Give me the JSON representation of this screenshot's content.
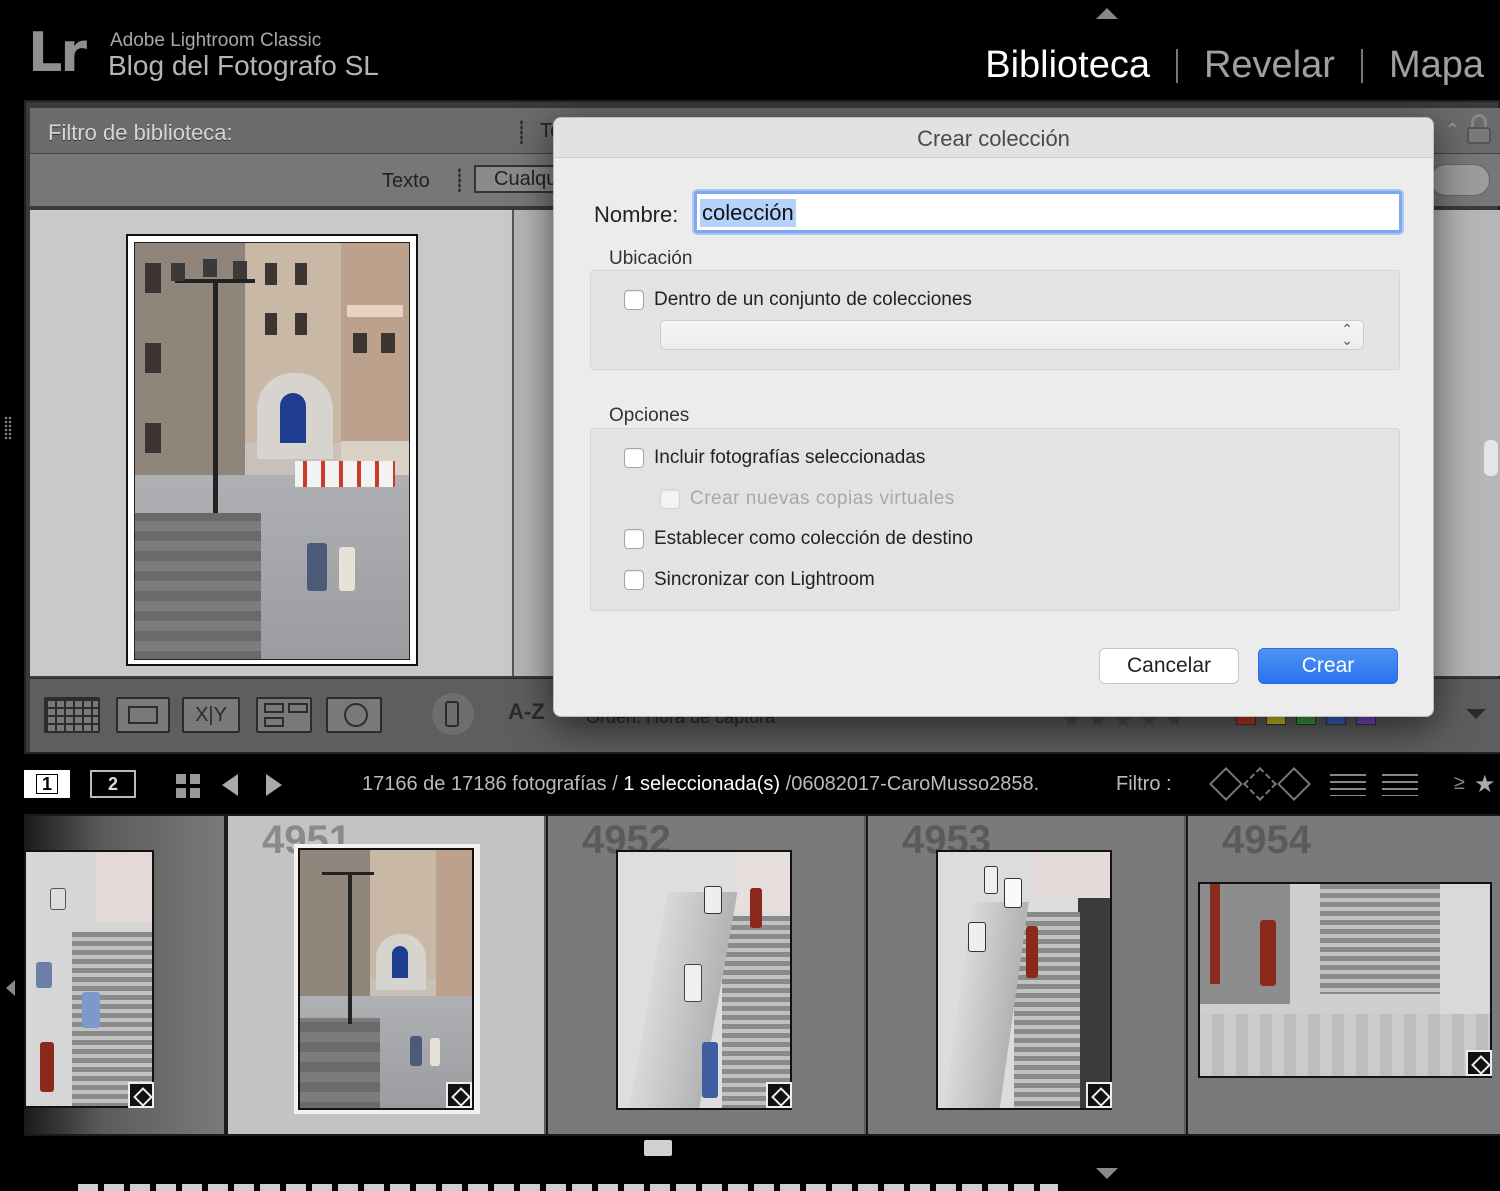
{
  "identity": {
    "logo": "Lr",
    "app_name": "Adobe Lightroom Classic",
    "catalog_name": "Blog del Fotografo SL"
  },
  "modules": [
    {
      "label": "Biblioteca",
      "active": true
    },
    {
      "label": "Revelar",
      "active": false
    },
    {
      "label": "Mapa",
      "active": false
    }
  ],
  "filter_bar": {
    "title": "Filtro de biblioteca:",
    "partial_tab": "Te"
  },
  "text_filter": {
    "label": "Texto",
    "select_value": "Cualqu"
  },
  "toolbar": {
    "compare_label": "X|Y",
    "sort_icon": "A-Z",
    "sort_text": "Orden: Hora de captura",
    "stars": "★★★★★",
    "swatches": [
      "#c0392b",
      "#d4c02a",
      "#3aa33a",
      "#3a66c9",
      "#7b4bc4"
    ]
  },
  "filmstrip_bar": {
    "monitor1": "1",
    "monitor2": "2",
    "count_text": "17166 de 17186 fotografías /",
    "selected_text": "1 seleccionada(s)",
    "file_text": "/06082017-CaroMusso2858.",
    "filter_label": "Filtro :",
    "gte": "≥",
    "star": "★"
  },
  "filmstrip": {
    "cells": [
      {
        "number": "4951",
        "selected": true
      },
      {
        "number": "4952",
        "selected": false
      },
      {
        "number": "4953",
        "selected": false
      },
      {
        "number": "4954",
        "selected": false
      }
    ]
  },
  "dialog": {
    "title": "Crear colección",
    "name_label": "Nombre:",
    "name_value": "colección",
    "location_label": "Ubicación",
    "location_checkbox": "Dentro de un conjunto de colecciones",
    "options_label": "Opciones",
    "opt_include": "Incluir fotografías seleccionadas",
    "opt_virtual": "Crear nuevas copias virtuales",
    "opt_target": "Establecer como colección de destino",
    "opt_sync": "Sincronizar con Lightroom",
    "cancel_label": "Cancelar",
    "create_label": "Crear",
    "accent_color": "#2a73ef"
  }
}
